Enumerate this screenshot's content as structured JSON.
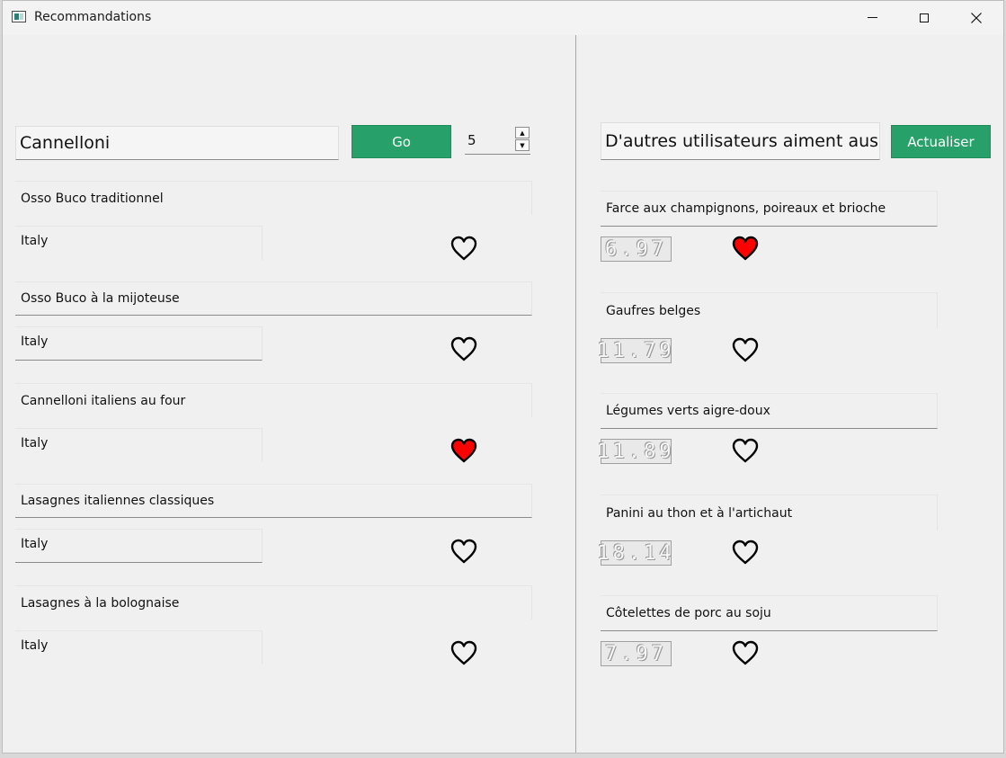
{
  "window": {
    "title": "Recommandations",
    "controls": [
      "minimize-icon",
      "maximize-icon",
      "close-icon"
    ]
  },
  "search": {
    "value": "Cannelloni",
    "button_label": "Go",
    "count": "5"
  },
  "results": [
    {
      "name": "Osso Buco traditionnel",
      "country": "Italy",
      "liked": false
    },
    {
      "name": "Osso Buco à la mijoteuse",
      "country": "Italy",
      "liked": false
    },
    {
      "name": "Cannelloni italiens au four",
      "country": "Italy",
      "liked": true
    },
    {
      "name": "Lasagnes italiennes classiques",
      "country": "Italy",
      "liked": false
    },
    {
      "name": "Lasagnes à la bolognaise",
      "country": "Italy",
      "liked": false
    }
  ],
  "others": {
    "field_value": "D'autres utilisateurs aiment aussi",
    "button_label": "Actualiser",
    "items": [
      {
        "name": "Farce aux champignons, poireaux et brioche",
        "score": "6.97",
        "liked": true
      },
      {
        "name": "Gaufres belges",
        "score": "11.79",
        "liked": false
      },
      {
        "name": "Légumes verts aigre-doux",
        "score": "11.89",
        "liked": false
      },
      {
        "name": "Panini au thon et à l'artichaut",
        "score": "18.14",
        "liked": false
      },
      {
        "name": "Côtelettes de porc au soju",
        "score": "7.97",
        "liked": false
      }
    ]
  },
  "colors": {
    "accent": "#27a06a",
    "heart_liked": "#ff0000",
    "heart_outline": "#000000"
  }
}
